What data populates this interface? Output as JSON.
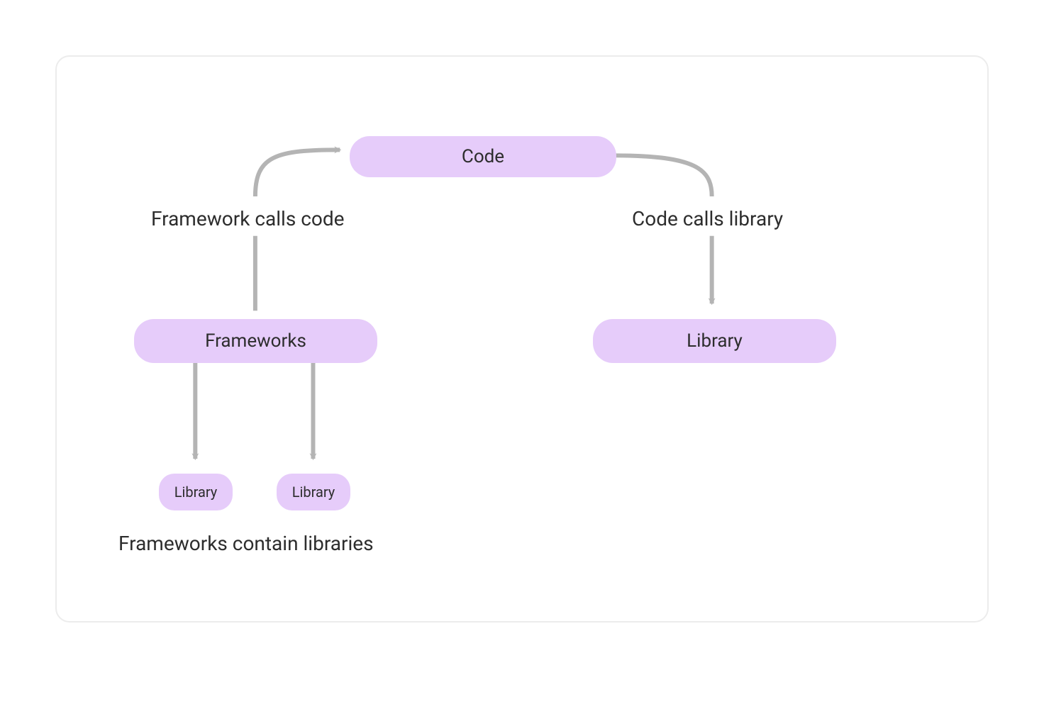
{
  "nodes": {
    "code": "Code",
    "frameworks": "Frameworks",
    "library": "Library",
    "lib_small_1": "Library",
    "lib_small_2": "Library"
  },
  "labels": {
    "framework_calls_code": "Framework calls code",
    "code_calls_library": "Code calls library",
    "frameworks_contain": "Frameworks contain libraries"
  },
  "colors": {
    "node_bg": "#e6ccfa",
    "arrow": "#b4b4b4",
    "text": "#2d2d2d",
    "border": "#ececec"
  }
}
